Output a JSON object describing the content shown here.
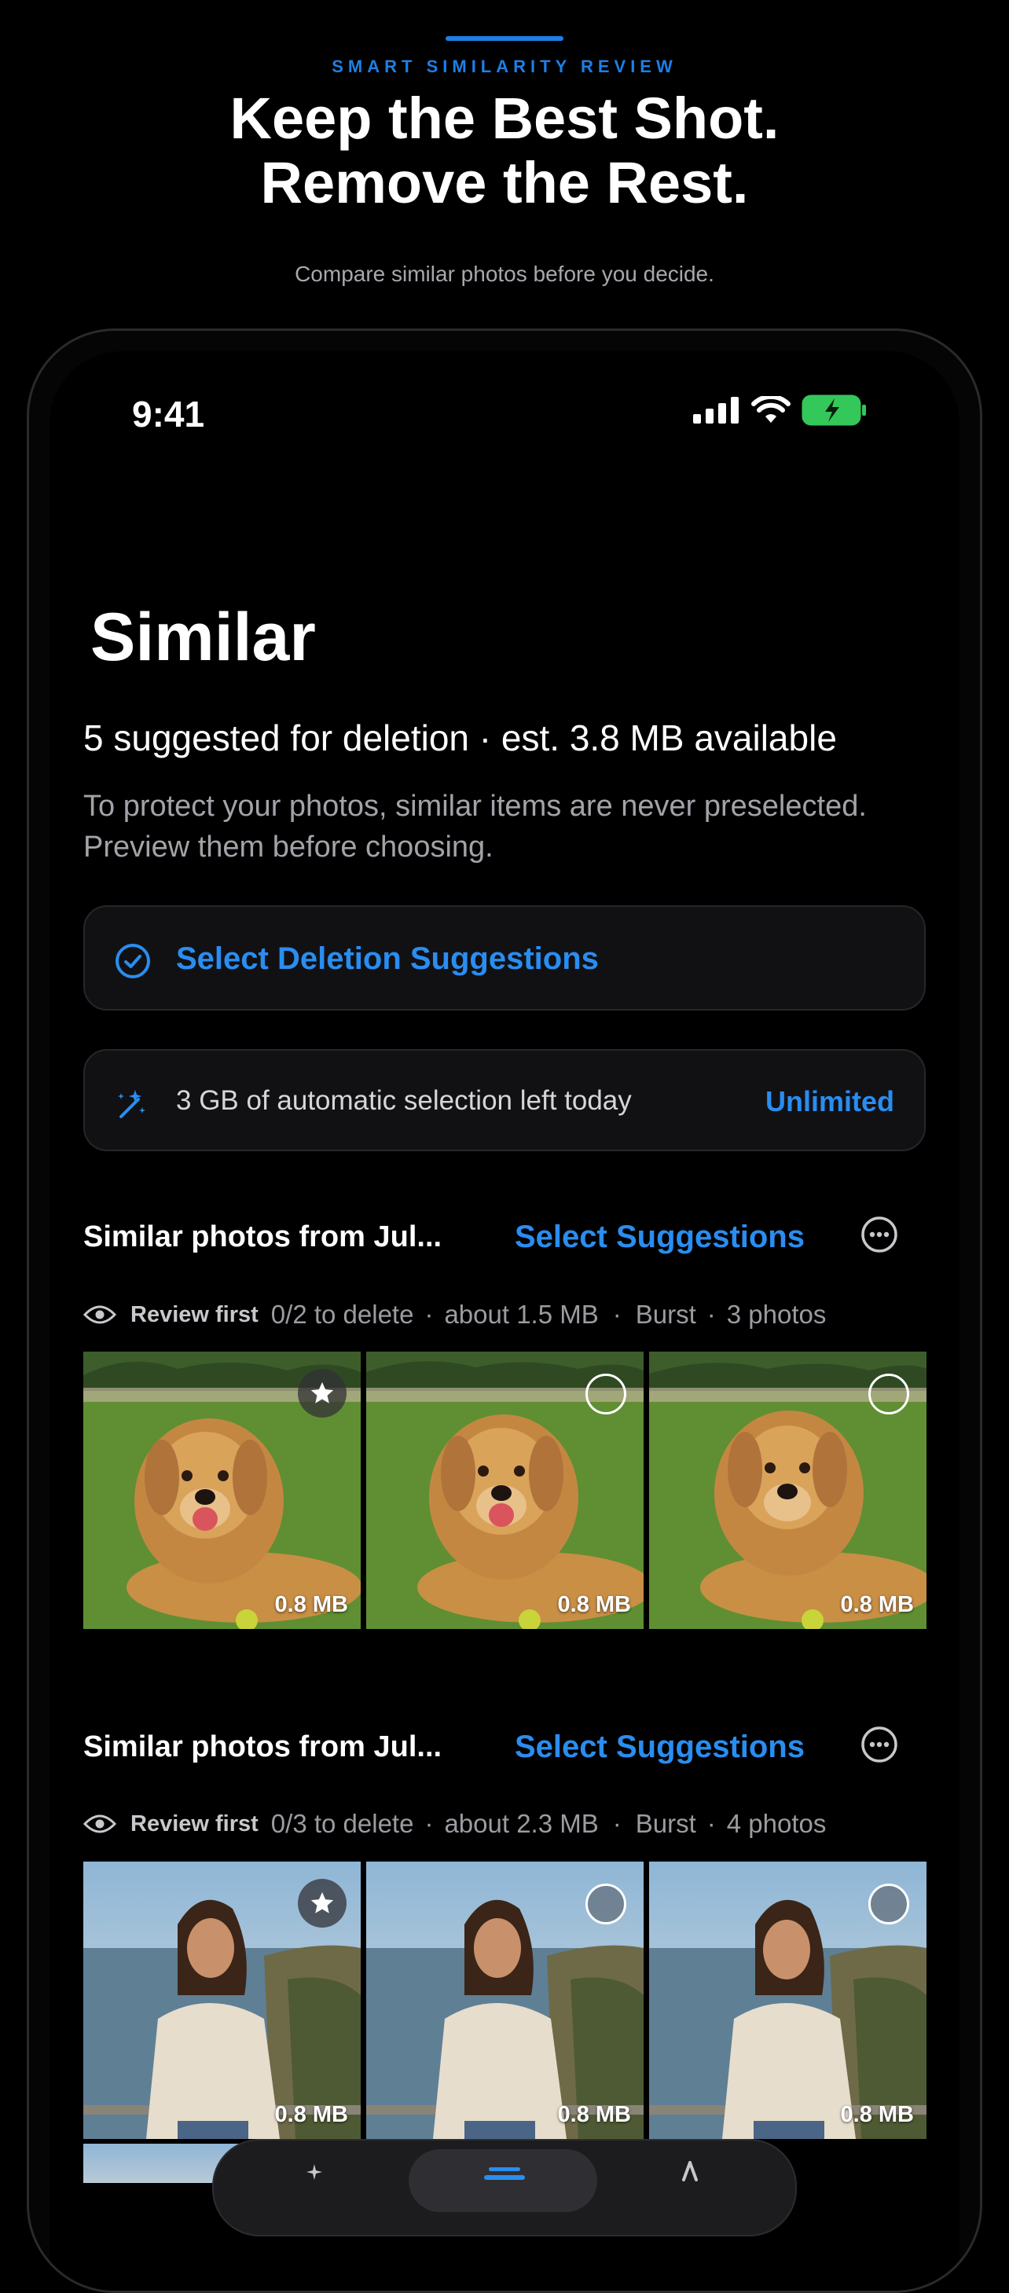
{
  "promo": {
    "eyebrow": "SMART SIMILARITY REVIEW",
    "headline_line1": "Keep the Best Shot.",
    "headline_line2": "Remove the Rest.",
    "subhead": "Compare similar photos before you decide."
  },
  "status_bar": {
    "time": "9:41",
    "icons": [
      "cellular-signal-icon",
      "wifi-icon",
      "battery-charging-icon"
    ],
    "battery_color": "#34c759"
  },
  "screen": {
    "title": "Similar",
    "summary": "5 suggested for deletion · est. 3.8 MB available",
    "description": "To protect your photos, similar items are never preselected. Preview them before choosing.",
    "select_all_label": "Select Deletion Suggestions",
    "quota_label": "3 GB of automatic selection left today",
    "quota_upgrade_label": "Unlimited"
  },
  "groups": [
    {
      "title": "Similar photos from Jul...",
      "select_label": "Select Suggestions",
      "review_label": "Review first",
      "delete_count": "0/2 to delete",
      "savings": "about 1.5 MB",
      "burst_label": "Burst",
      "photo_count": "3 photos",
      "photos": [
        {
          "size": "0.8 MB",
          "badge": "star-icon"
        },
        {
          "size": "0.8 MB",
          "badge": "selection-circle"
        },
        {
          "size": "0.8 MB",
          "badge": "selection-circle"
        }
      ]
    },
    {
      "title": "Similar photos from Jul...",
      "select_label": "Select Suggestions",
      "review_label": "Review first",
      "delete_count": "0/3 to delete",
      "savings": "about 2.3 MB",
      "burst_label": "Burst",
      "photo_count": "4 photos",
      "photos": [
        {
          "size": "0.8 MB",
          "badge": "star-icon"
        },
        {
          "size": "0.8 MB",
          "badge": "selection-circle"
        },
        {
          "size": "0.8 MB",
          "badge": "selection-circle"
        }
      ]
    }
  ],
  "colors": {
    "accent": "#2a8df0",
    "background": "#000000",
    "card": "#111114"
  }
}
